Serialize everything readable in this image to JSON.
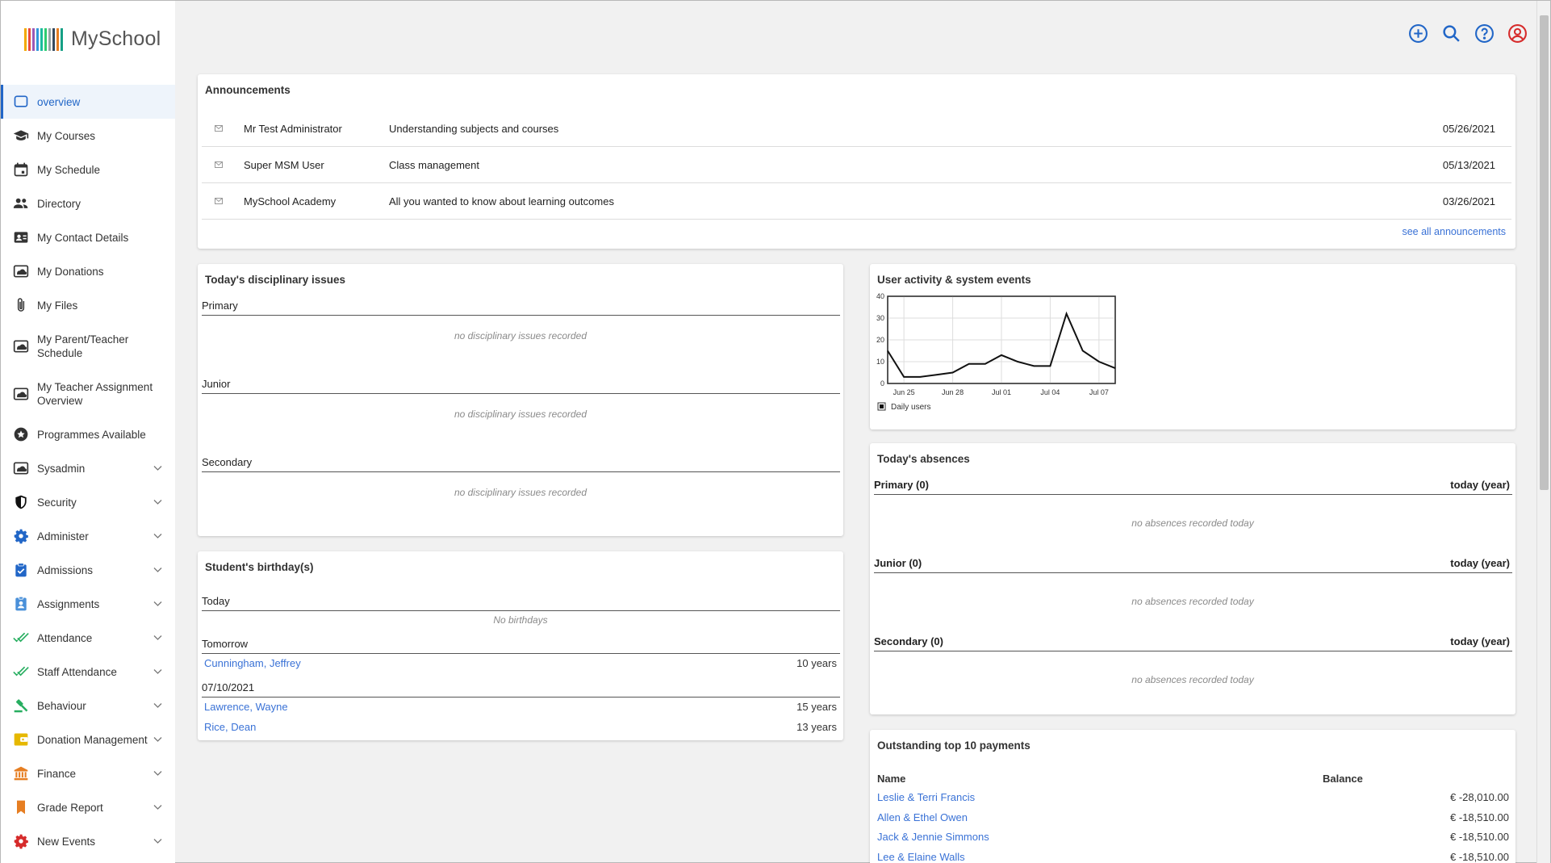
{
  "app": {
    "name": "MySchool",
    "logo_colors": [
      "#f2a900",
      "#e84c3d",
      "#9b59b6",
      "#3498db",
      "#1abc9c",
      "#2ecc71",
      "#95a5a6",
      "#34495e",
      "#e67e22",
      "#16a085"
    ]
  },
  "sidebar": {
    "items": [
      {
        "label": "overview",
        "icon": "overview-icon",
        "color": "#2166c7",
        "active": true
      },
      {
        "label": "My Courses",
        "icon": "graduation-cap-icon",
        "color": "#333"
      },
      {
        "label": "My Schedule",
        "icon": "calendar-icon",
        "color": "#333"
      },
      {
        "label": "Directory",
        "icon": "people-icon",
        "color": "#333"
      },
      {
        "label": "My Contact Details",
        "icon": "contact-card-icon",
        "color": "#333"
      },
      {
        "label": "My Donations",
        "icon": "cloud-folder-icon",
        "color": "#333"
      },
      {
        "label": "My Files",
        "icon": "paperclip-icon",
        "color": "#333"
      },
      {
        "label": "My Parent/Teacher Schedule",
        "icon": "cloud-folder-icon",
        "color": "#333",
        "two": true
      },
      {
        "label": "My Teacher Assignment Overview",
        "icon": "cloud-folder-icon",
        "color": "#333",
        "two": true
      },
      {
        "label": "Programmes Available",
        "icon": "star-badge-icon",
        "color": "#333"
      },
      {
        "label": "Sysadmin",
        "icon": "cloud-folder-icon",
        "color": "#333",
        "expand": true
      },
      {
        "label": "Security",
        "icon": "shield-icon",
        "color": "#111",
        "expand": true
      },
      {
        "label": "Administer",
        "icon": "gear-icon",
        "color": "#2166c7",
        "expand": true
      },
      {
        "label": "Admissions",
        "icon": "clipboard-check-icon",
        "color": "#2166c7",
        "expand": true
      },
      {
        "label": "Assignments",
        "icon": "id-badge-icon",
        "color": "#4a90d9",
        "expand": true
      },
      {
        "label": "Attendance",
        "icon": "double-check-icon",
        "color": "#27ae60",
        "expand": true
      },
      {
        "label": "Staff Attendance",
        "icon": "double-check-icon",
        "color": "#27ae60",
        "expand": true
      },
      {
        "label": "Behaviour",
        "icon": "gavel-icon",
        "color": "#27ae60",
        "expand": true
      },
      {
        "label": "Donation Management",
        "icon": "wallet-icon",
        "color": "#e6b800",
        "expand": true
      },
      {
        "label": "Finance",
        "icon": "bank-icon",
        "color": "#e67e22",
        "expand": true
      },
      {
        "label": "Grade Report",
        "icon": "bookmark-icon",
        "color": "#e67e22",
        "expand": true
      },
      {
        "label": "New Events",
        "icon": "gear-icon",
        "color": "#d62b2b",
        "expand": true
      }
    ]
  },
  "toolbar": {
    "icons": [
      "add-icon",
      "search-icon",
      "help-icon",
      "user-icon"
    ],
    "colors": [
      "#2166c7",
      "#2166c7",
      "#2166c7",
      "#d62b2b"
    ]
  },
  "announcements": {
    "title": "Announcements",
    "rows": [
      {
        "from": "Mr Test Administrator",
        "subject": "Understanding subjects and courses",
        "date": "05/26/2021"
      },
      {
        "from": "Super MSM User",
        "subject": "Class management",
        "date": "05/13/2021"
      },
      {
        "from": "MySchool Academy",
        "subject": "All you wanted to know about learning outcomes",
        "date": "03/26/2021"
      }
    ],
    "see_all": "see all announcements"
  },
  "discipline": {
    "title": "Today's disciplinary issues",
    "sections": [
      {
        "name": "Primary",
        "empty": "no disciplinary issues recorded"
      },
      {
        "name": "Junior",
        "empty": "no disciplinary issues recorded"
      },
      {
        "name": "Secondary",
        "empty": "no disciplinary issues recorded"
      }
    ]
  },
  "birthdays": {
    "title": "Student's birthday(s)",
    "today_label": "Today",
    "today_empty": "No birthdays",
    "tomorrow_label": "Tomorrow",
    "tomorrow": [
      {
        "name": "Cunningham, Jeffrey",
        "age": "10 years"
      }
    ],
    "date_label": "07/10/2021",
    "date_rows": [
      {
        "name": "Lawrence, Wayne",
        "age": "15 years"
      },
      {
        "name": "Rice, Dean",
        "age": "13 years"
      }
    ]
  },
  "activity": {
    "title": "User activity & system events",
    "chart_data": {
      "type": "line",
      "x": [
        "Jun 24",
        "Jun 25",
        "Jun 26",
        "Jun 27",
        "Jun 28",
        "Jun 29",
        "Jun 30",
        "Jul 01",
        "Jul 02",
        "Jul 03",
        "Jul 04",
        "Jul 05",
        "Jul 06",
        "Jul 07",
        "Jul 08"
      ],
      "series": [
        {
          "name": "Daily users",
          "values": [
            15,
            3,
            3,
            4,
            5,
            9,
            9,
            13,
            10,
            8,
            8,
            32,
            15,
            10,
            7
          ]
        }
      ],
      "x_ticks": [
        "Jun 25",
        "Jun 28",
        "Jul 01",
        "Jul 04",
        "Jul 07"
      ],
      "y_ticks": [
        "0",
        "10",
        "20",
        "30",
        "40"
      ],
      "ylim": [
        0,
        40
      ],
      "grid": true,
      "legend": "bottom-left"
    }
  },
  "absences": {
    "title": "Today's absences",
    "right_label": "today (year)",
    "sections": [
      {
        "name": "Primary (0)",
        "empty": "no absences recorded today"
      },
      {
        "name": "Junior (0)",
        "empty": "no absences recorded today"
      },
      {
        "name": "Secondary (0)",
        "empty": "no absences recorded today"
      }
    ]
  },
  "payments": {
    "title": "Outstanding top 10 payments",
    "col_name": "Name",
    "col_balance": "Balance",
    "rows": [
      {
        "name": "Leslie & Terri Francis",
        "balance": "€ -28,010.00"
      },
      {
        "name": "Allen & Ethel Owen",
        "balance": "€ -18,510.00"
      },
      {
        "name": "Jack & Jennie Simmons",
        "balance": "€ -18,510.00"
      },
      {
        "name": "Lee & Elaine Walls",
        "balance": "€ -18,510.00"
      }
    ]
  }
}
